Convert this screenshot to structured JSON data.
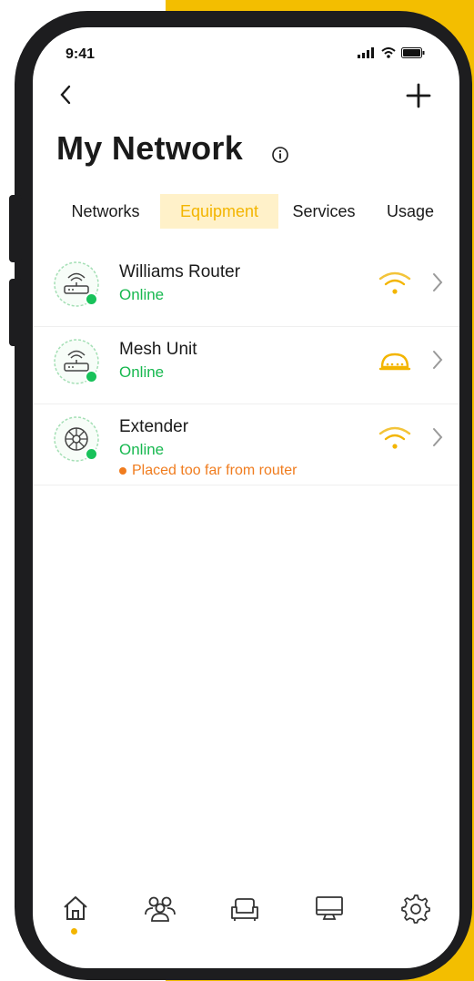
{
  "status_bar": {
    "time": "9:41"
  },
  "header": {
    "title": "My Network"
  },
  "tabs": [
    {
      "label": "Networks",
      "active": false
    },
    {
      "label": "Equipment",
      "active": true
    },
    {
      "label": "Services",
      "active": false
    },
    {
      "label": "Usage",
      "active": false
    }
  ],
  "devices": [
    {
      "name": "Williams Router",
      "status": "Online",
      "warning": "",
      "icon": "router-icon",
      "signal": "wifi-signal-icon"
    },
    {
      "name": "Mesh Unit",
      "status": "Online",
      "warning": "",
      "icon": "mesh-unit-icon",
      "signal": "mesh-signal-icon"
    },
    {
      "name": "Extender",
      "status": "Online",
      "warning": "Placed too far from router",
      "icon": "extender-icon",
      "signal": "wifi-signal-icon"
    }
  ],
  "bottom_nav": [
    {
      "icon": "home-icon",
      "active": true
    },
    {
      "icon": "people-icon",
      "active": false
    },
    {
      "icon": "sofa-icon",
      "active": false
    },
    {
      "icon": "monitor-icon",
      "active": false
    },
    {
      "icon": "gear-icon",
      "active": false
    }
  ],
  "colors": {
    "accent": "#f3b500",
    "accent_background": "#f3be00",
    "online": "#17b84f",
    "warning": "#f07c1e",
    "phone_frame": "#1d1d1f"
  }
}
